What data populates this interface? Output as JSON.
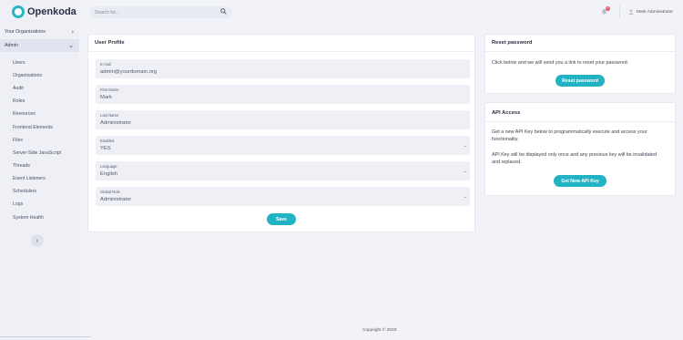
{
  "app": {
    "name": "Openkoda"
  },
  "search": {
    "placeholder": "Search for..."
  },
  "header": {
    "notification_count": "0",
    "user_name": "Mark Administrator"
  },
  "sidebar": {
    "your_organizations": "Your Organizations",
    "admin": "Admin",
    "items": [
      "Users",
      "Organizations",
      "Audit",
      "Roles",
      "Resources",
      "Frontend Elements",
      "Files",
      "Server-Side JavaScript",
      "Threads",
      "Event Listeners",
      "Schedulers",
      "Logs",
      "System Health"
    ]
  },
  "profile": {
    "title": "User Profile",
    "fields": [
      {
        "label": "E-mail",
        "value": "admin@yourdomain.org"
      },
      {
        "label": "First Name",
        "value": "Mark"
      },
      {
        "label": "Last Name",
        "value": "Administrator"
      },
      {
        "label": "Enabled",
        "value": "YES"
      },
      {
        "label": "Language",
        "value": "English"
      },
      {
        "label": "Global Role",
        "value": "Administrator"
      }
    ],
    "save_label": "Save"
  },
  "reset_password": {
    "title": "Reset password",
    "text": "Click below and we will send you a link to reset your password.",
    "button_label": "Reset password"
  },
  "api_access": {
    "title": "API Access",
    "text1": "Get a new API Key below to programmatically execute and access your functionality.",
    "text2": "API Key will be displayed only once and any previous key will be invalidated and replaced.",
    "button_label": "Get New API Key"
  },
  "footer": {
    "copyright": "Copyright © 2023"
  },
  "colors": {
    "accent": "#21b3c4",
    "sidebar_bg": "#eef0f6",
    "page_bg": "#f2f3f8"
  }
}
